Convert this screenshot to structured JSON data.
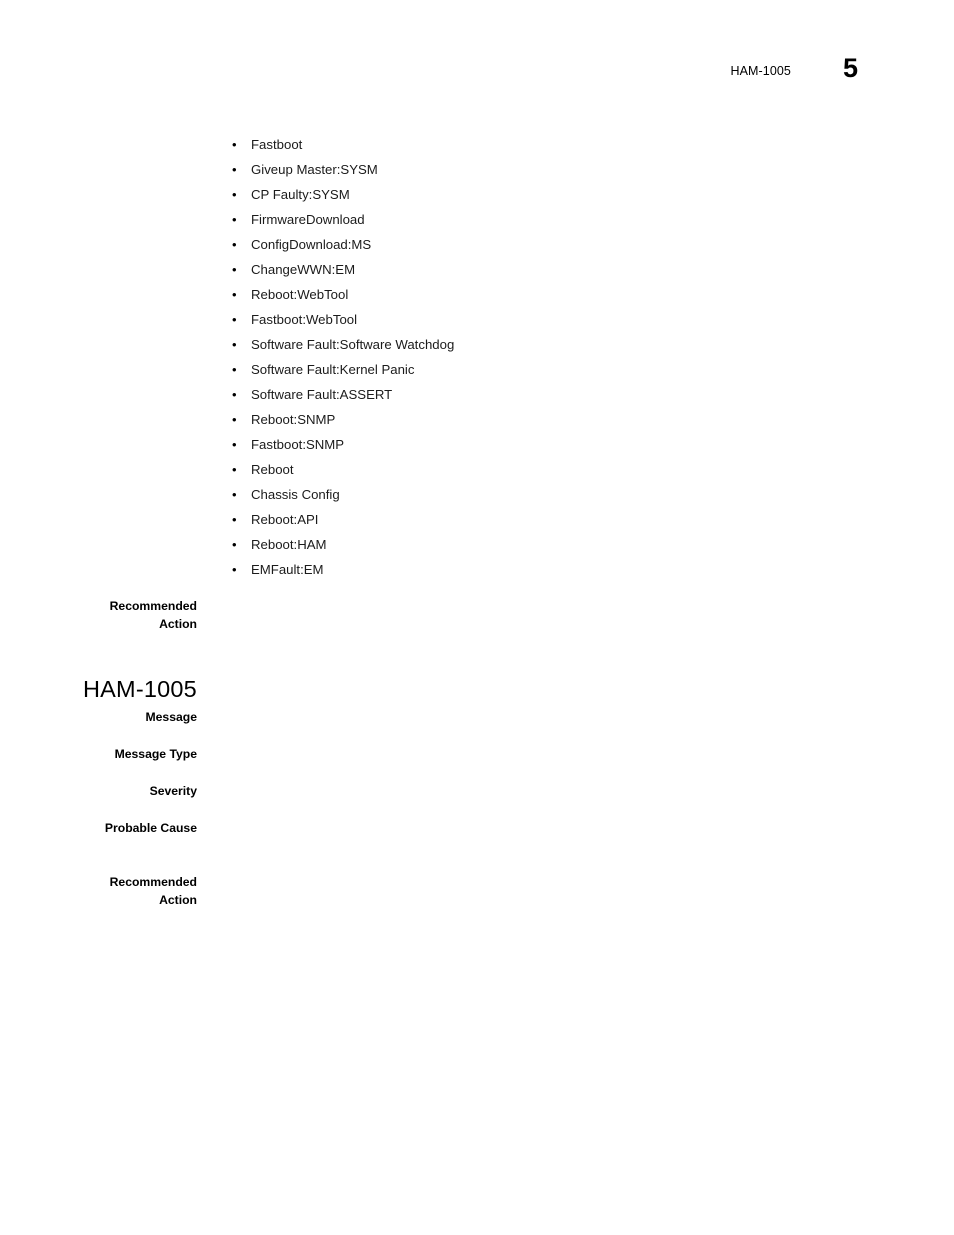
{
  "document": {
    "page_number": "5",
    "running_header": "HAM-1005"
  },
  "bullet_list": {
    "items": [
      {
        "marker": "•",
        "text": "Fastboot"
      },
      {
        "marker": "•",
        "text": "Giveup Master:SYSM"
      },
      {
        "marker": "•",
        "text": "CP Faulty:SYSM"
      },
      {
        "marker": "•",
        "text": "FirmwareDownload"
      },
      {
        "marker": "•",
        "text": "ConfigDownload:MS"
      },
      {
        "marker": "•",
        "text": "ChangeWWN:EM"
      },
      {
        "marker": "•",
        "text": "Reboot:WebTool"
      },
      {
        "marker": "•",
        "text": "Fastboot:WebTool"
      },
      {
        "marker": "•",
        "text": "Software Fault:Software Watchdog"
      },
      {
        "marker": "•",
        "text": "Software Fault:Kernel Panic"
      },
      {
        "marker": "•",
        "text": "Software Fault:ASSERT"
      },
      {
        "marker": "•",
        "text": "Reboot:SNMP"
      },
      {
        "marker": "•",
        "text": "Fastboot:SNMP"
      },
      {
        "marker": "•",
        "text": "Reboot"
      },
      {
        "marker": "•",
        "text": "Chassis Config"
      },
      {
        "marker": "•",
        "text": "Reboot:API"
      },
      {
        "marker": "•",
        "text": "Reboot:HAM"
      },
      {
        "marker": "•",
        "text": "EMFault:EM"
      }
    ]
  },
  "previous_entry": {
    "recommended_action_label_line1": "Recommended",
    "recommended_action_label_line2": "Action",
    "recommended_action_value": ""
  },
  "entry": {
    "heading": "HAM-1005",
    "fields": {
      "message_label": "Message",
      "message_value": "",
      "message_type_label": "Message Type",
      "message_type_value": "",
      "severity_label": "Severity",
      "severity_value": "",
      "probable_cause_label": "Probable Cause",
      "probable_cause_value": "",
      "recommended_action_label_line1": "Recommended",
      "recommended_action_label_line2": "Action",
      "recommended_action_value": ""
    }
  }
}
